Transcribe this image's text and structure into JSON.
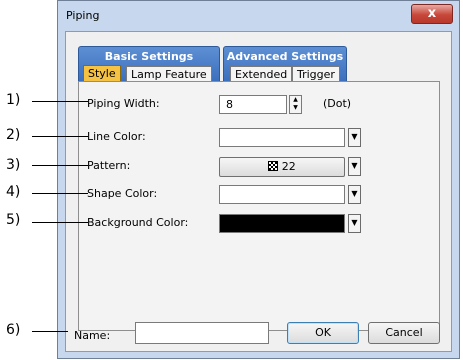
{
  "window": {
    "title": "Piping",
    "close_icon": "close-icon",
    "close_symbol": "x"
  },
  "tabs": {
    "basic": {
      "label": "Basic Settings",
      "subtabs": [
        "Style",
        "Lamp Feature"
      ],
      "active_subtab": "Style"
    },
    "advanced": {
      "label": "Advanced Settings",
      "subtabs": [
        "Extended",
        "Trigger"
      ]
    }
  },
  "fields": {
    "piping_width": {
      "label": "Piping Width:",
      "value": "8",
      "unit": "(Dot)"
    },
    "line_color": {
      "label": "Line Color:",
      "value_color": "#ffffff"
    },
    "pattern": {
      "label": "Pattern:",
      "value": "22",
      "icon": "checker-pattern-icon"
    },
    "shape_color": {
      "label": "Shape Color:",
      "value_color": "#ffffff"
    },
    "background_color": {
      "label": "Background Color:",
      "value_color": "#000000"
    }
  },
  "footer": {
    "name_label": "Name:",
    "name_value": "",
    "ok_label": "OK",
    "cancel_label": "Cancel"
  },
  "callouts": [
    "1)",
    "2)",
    "3)",
    "4)",
    "5)",
    "6)"
  ],
  "colors": {
    "tab_group_bg": "#4a7fcb",
    "active_tab": "#f6c244",
    "window_frame": "#c7d8ee",
    "close_button": "#c7473a"
  }
}
